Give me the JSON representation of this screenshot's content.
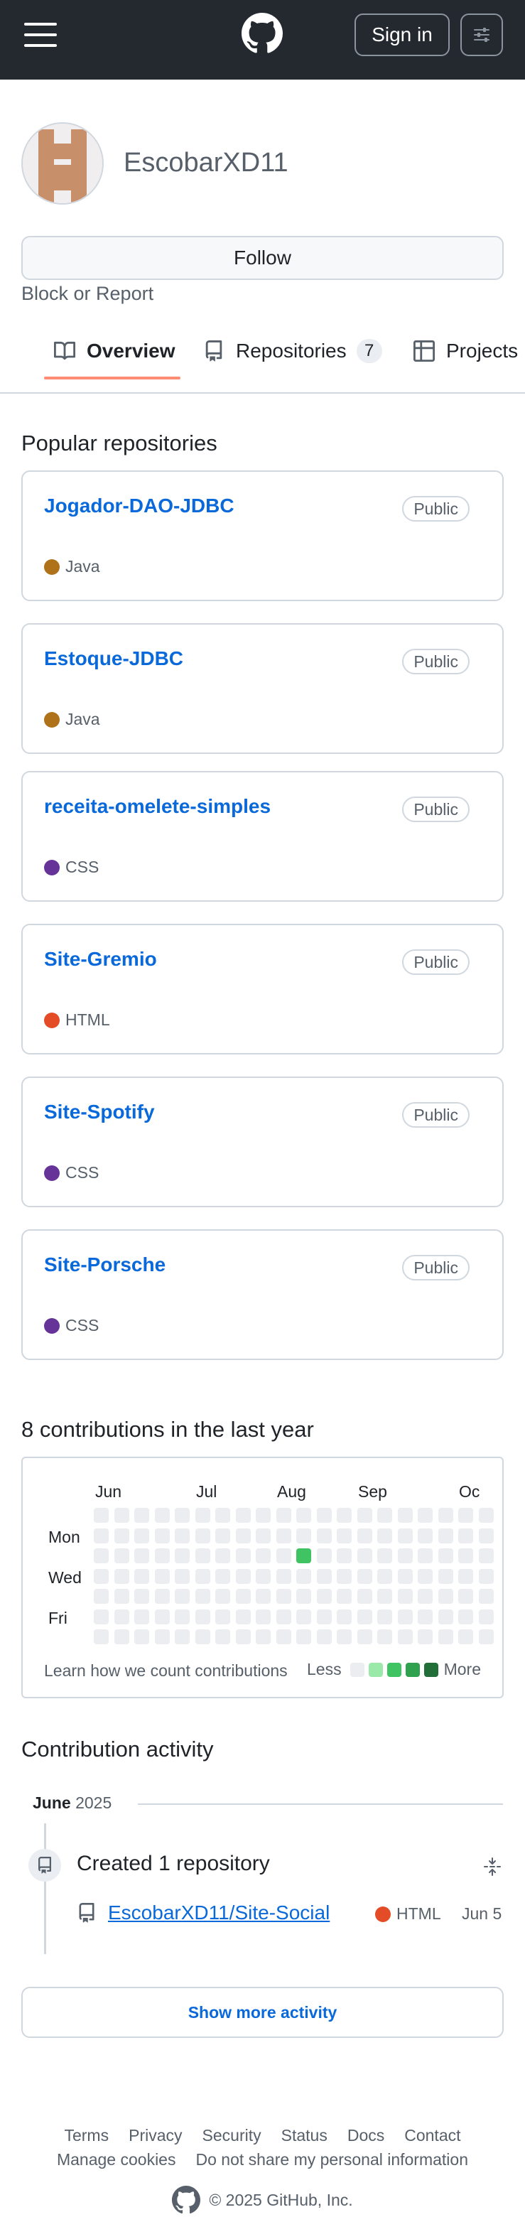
{
  "header": {
    "signin_label": "Sign in"
  },
  "profile": {
    "username": "EscobarXD11",
    "follow_label": "Follow",
    "block_label": "Block or Report"
  },
  "tabs": [
    {
      "label": "Overview",
      "icon": "book-icon"
    },
    {
      "label": "Repositories",
      "icon": "repo-icon",
      "count": "7"
    },
    {
      "label": "Projects",
      "icon": "table-icon"
    }
  ],
  "popular": {
    "title": "Popular repositories",
    "repos": [
      {
        "name": "Jogador-DAO-JDBC",
        "visibility": "Public",
        "language": "Java",
        "color": "#b07219"
      },
      {
        "name": "Estoque-JDBC",
        "visibility": "Public",
        "language": "Java",
        "color": "#b07219"
      },
      {
        "name": "receita-omelete-simples",
        "visibility": "Public",
        "language": "CSS",
        "color": "#663399"
      },
      {
        "name": "Site-Gremio",
        "visibility": "Public",
        "language": "HTML",
        "color": "#e34c26"
      },
      {
        "name": "Site-Spotify",
        "visibility": "Public",
        "language": "CSS",
        "color": "#663399"
      },
      {
        "name": "Site-Porsche",
        "visibility": "Public",
        "language": "CSS",
        "color": "#663399"
      }
    ]
  },
  "contributions": {
    "title": "8 contributions in the last year",
    "months": [
      "Jun",
      "Jul",
      "Aug",
      "Sep",
      "Oc"
    ],
    "days": [
      "Mon",
      "Wed",
      "Fri"
    ],
    "learn_label": "Learn how we count contributions",
    "less_label": "Less",
    "more_label": "More",
    "level_colors": [
      "#ebedf0",
      "#9be9a8",
      "#40c463",
      "#30a14e",
      "#216e39"
    ]
  },
  "activity": {
    "title": "Contribution activity",
    "period_month": "June",
    "period_year": "2025",
    "event_title": "Created 1 repository",
    "repo_link": "EscobarXD11/Site-Social",
    "repo_language": "HTML",
    "repo_language_color": "#e34c26",
    "repo_date": "Jun 5",
    "show_more_label": "Show more activity"
  },
  "footer": {
    "row1": [
      "Terms",
      "Privacy",
      "Security",
      "Status",
      "Docs",
      "Contact"
    ],
    "row2": [
      "Manage cookies",
      "Do not share my personal information"
    ],
    "copyright": "© 2025 GitHub, Inc."
  }
}
